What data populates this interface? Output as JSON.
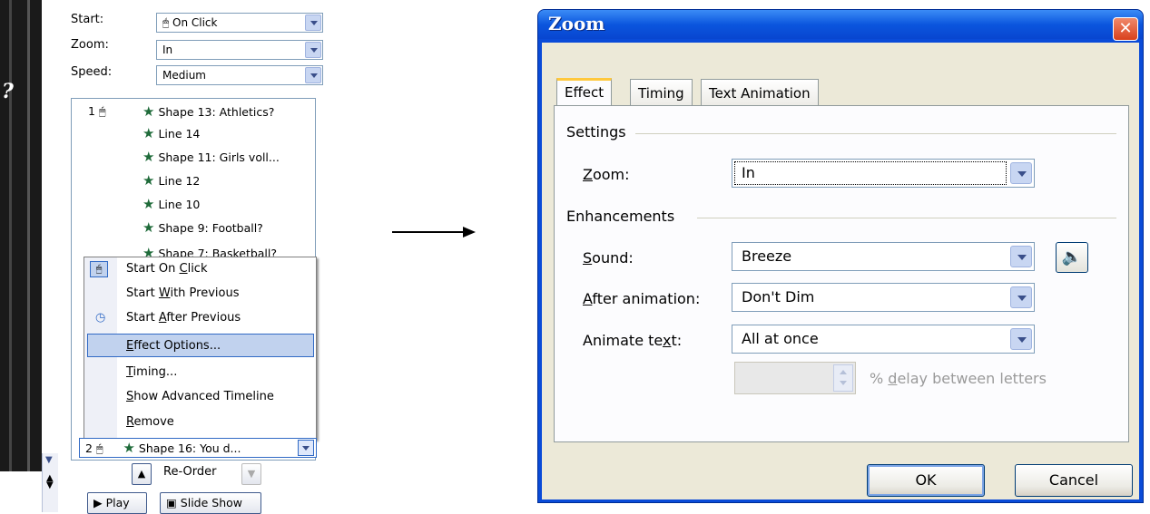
{
  "taskpane": {
    "start_label": "Start:",
    "start_value": "On Click",
    "zoom_label": "Zoom:",
    "zoom_value": "In",
    "speed_label": "Speed:",
    "speed_value": "Medium",
    "slide_char": "?",
    "list_items": [
      {
        "num": "1",
        "text": "Shape 13: Athletics?"
      },
      {
        "num": "",
        "text": "Line 14"
      },
      {
        "num": "",
        "text": "Shape 11: Girls voll..."
      },
      {
        "num": "",
        "text": "Line 12"
      },
      {
        "num": "",
        "text": "Line 10"
      },
      {
        "num": "",
        "text": "Shape 9: Football?"
      },
      {
        "num": "",
        "text": "Shape 7: Basketball?"
      }
    ],
    "last_item": {
      "num": "2",
      "text": "Shape 16: You d..."
    },
    "reorder_label": "Re-Order",
    "play_label": "Play",
    "slideshow_label": "Slide Show"
  },
  "context_menu": {
    "items": [
      {
        "pre": "Start On ",
        "key": "C",
        "post": "lick"
      },
      {
        "pre": "Start ",
        "key": "W",
        "post": "ith Previous"
      },
      {
        "pre": "Start ",
        "key": "A",
        "post": "fter Previous"
      },
      {
        "pre": "",
        "key": "E",
        "post": "ffect Options..."
      },
      {
        "pre": "",
        "key": "T",
        "post": "iming..."
      },
      {
        "pre": "",
        "key": "S",
        "post": "how Advanced Timeline"
      },
      {
        "pre": "",
        "key": "R",
        "post": "emove"
      }
    ],
    "selected_index": 3
  },
  "dialog": {
    "title": "Zoom",
    "close_glyph": "✕",
    "tabs": [
      "Effect",
      "Timing",
      "Text Animation"
    ],
    "active_tab": "Effect",
    "settings_group": "Settings",
    "zoom": {
      "pre": "",
      "key": "Z",
      "post": "oom:",
      "value": "In"
    },
    "enhancements_group": "Enhancements",
    "sound": {
      "pre": "",
      "key": "S",
      "post": "ound:",
      "value": "Breeze"
    },
    "after_animation": {
      "pre": "",
      "key": "A",
      "post": "fter animation:",
      "value": "Don't Dim"
    },
    "animate_text": {
      "pre": "Animate te",
      "key": "x",
      "post": "t:",
      "value": "All at once"
    },
    "delay": {
      "value": "",
      "pre": "% ",
      "key": "d",
      "post": "elay between letters"
    },
    "ok_label": "OK",
    "cancel_label": "Cancel"
  }
}
